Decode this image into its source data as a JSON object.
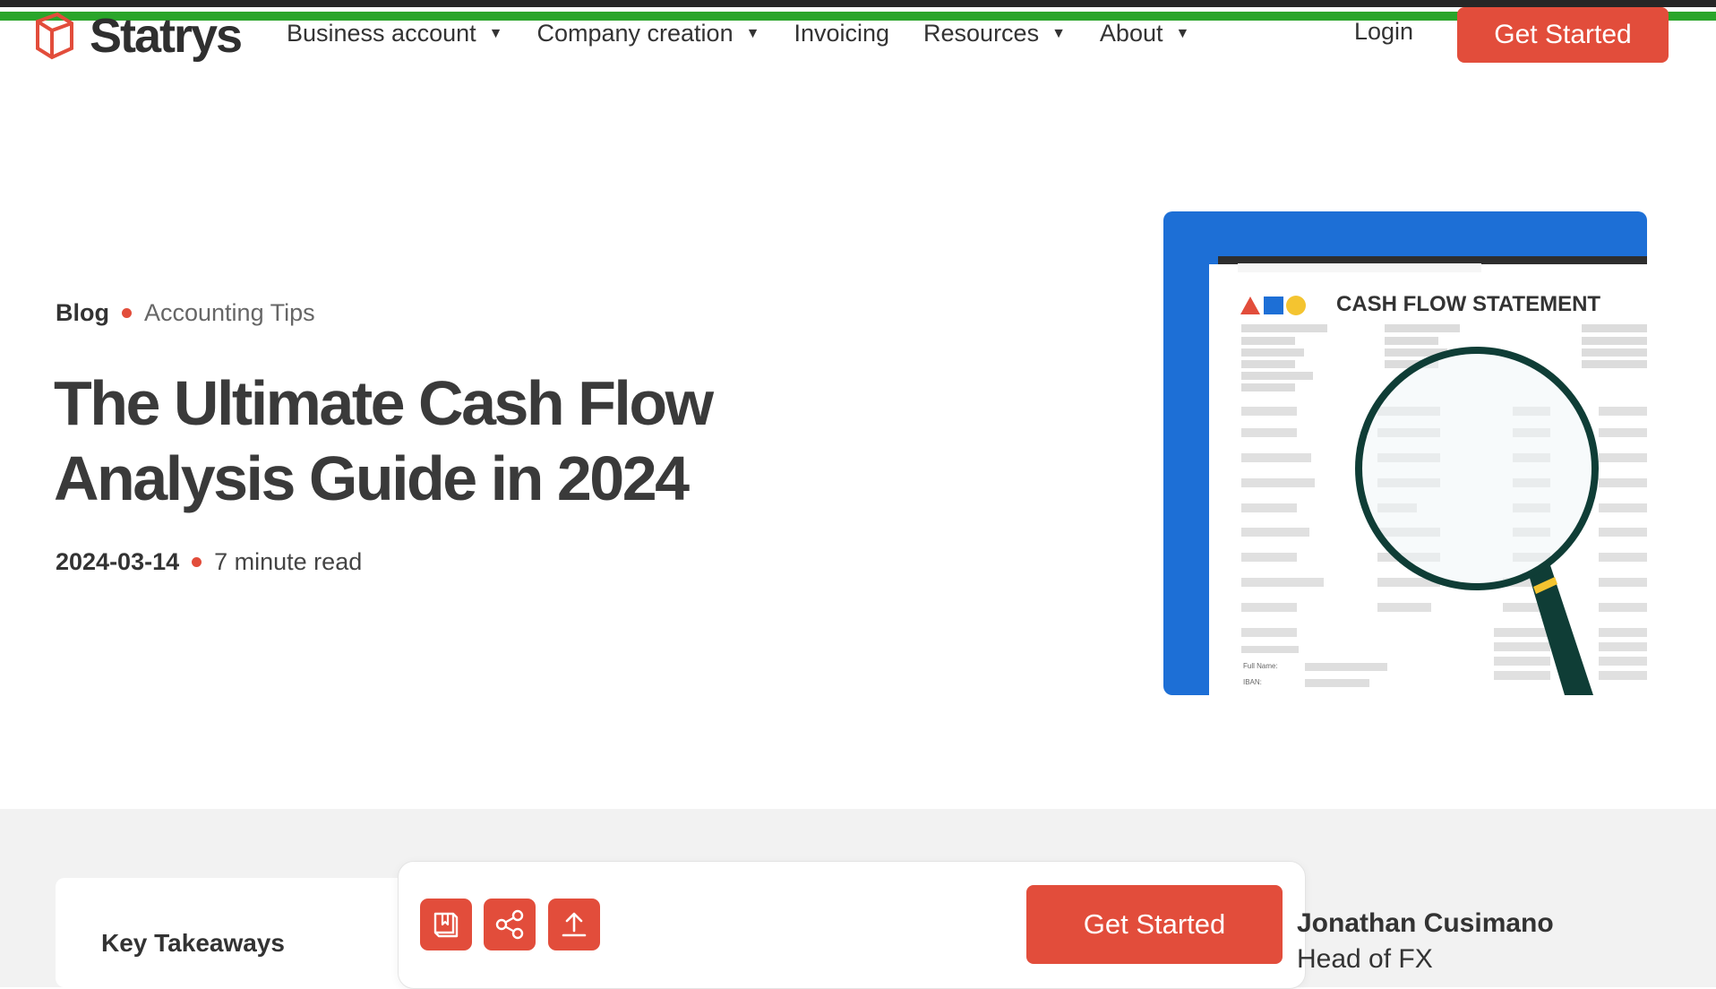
{
  "brand": {
    "name": "Statrys",
    "accent": "#e24d3b"
  },
  "nav": {
    "items": [
      {
        "label": "Business account",
        "has_dropdown": true
      },
      {
        "label": "Company creation",
        "has_dropdown": true
      },
      {
        "label": "Invoicing",
        "has_dropdown": false
      },
      {
        "label": "Resources",
        "has_dropdown": true
      },
      {
        "label": "About",
        "has_dropdown": true
      }
    ],
    "login": "Login",
    "cta": "Get Started"
  },
  "article": {
    "breadcrumb": {
      "root": "Blog",
      "category": "Accounting Tips"
    },
    "title": "The Ultimate Cash Flow Analysis Guide in 2024",
    "date": "2024-03-14",
    "read_time": "7 minute read"
  },
  "hero_image": {
    "heading": "CASH FLOW STATEMENT",
    "form_labels": [
      "Full Name:",
      "IBAN:"
    ],
    "frame_color": "#1d6fd6"
  },
  "bottom": {
    "takeaways": "Key Takeaways",
    "actions": [
      {
        "icon": "book-icon"
      },
      {
        "icon": "share-icon"
      },
      {
        "icon": "upload-icon"
      }
    ],
    "cta": "Get Started",
    "author": {
      "name": "Jonathan Cusimano",
      "role": "Head of FX"
    }
  }
}
